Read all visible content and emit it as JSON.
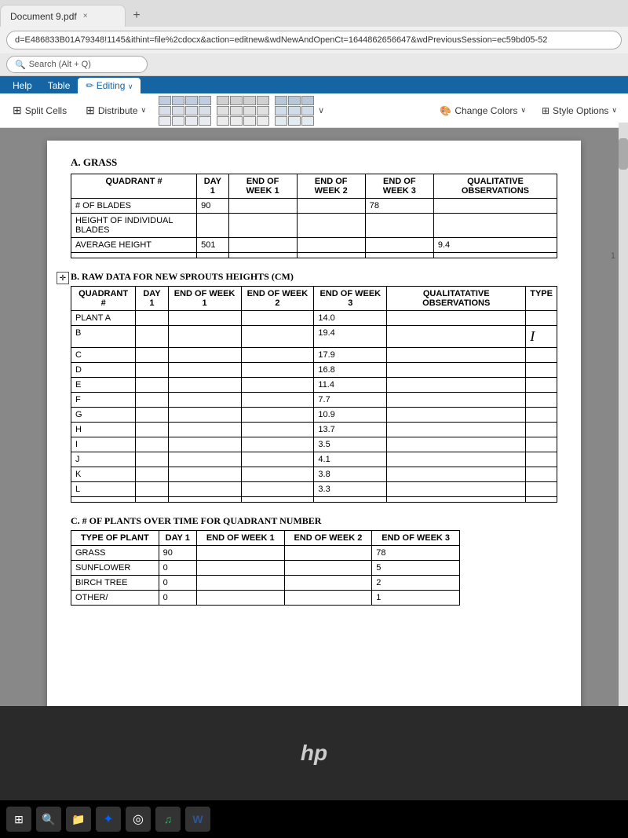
{
  "browser": {
    "tab_label": "Document 9.pdf",
    "tab_close": "×",
    "tab_new": "+",
    "address_url": "d=E486833B01A79348!1145&ithint=file%2cdocx&action=editnew&wdNewAndOpenCt=1644862656647&wdPreviousSession=ec59bd05-52",
    "search_placeholder": "Search (Alt + Q)"
  },
  "ribbon": {
    "tabs": [
      "Help",
      "Table",
      "Editing",
      "Distribute"
    ],
    "active_tab": "Editing",
    "toolbar": {
      "split_cells_label": "Split Cells",
      "distribute_label": "Distribute",
      "change_colors_label": "Change Colors",
      "style_options_label": "Style Options"
    }
  },
  "document": {
    "section_a": {
      "label": "A.   GRASS",
      "headers": [
        "QUADRANT #",
        "DAY 1",
        "END OF WEEK 1",
        "END OF WEEK 2",
        "END OF WEEK 3",
        "QUALITATIVE OBSERVATIONS"
      ],
      "rows": [
        [
          "# OF BLADES",
          "90",
          "",
          "",
          "78",
          ""
        ],
        [
          "HEIGHT OF INDIVIDUAL BLADES",
          "",
          "",
          "",
          "",
          ""
        ],
        [
          "AVERAGE HEIGHT",
          "501",
          "",
          "",
          "",
          "9.4"
        ],
        [
          "",
          "",
          "",
          "",
          "",
          ""
        ]
      ]
    },
    "section_b": {
      "label": "B.   RAW DATA FOR NEW SPROUTS   HEIGHTS (CM)",
      "headers": [
        "QUADRANT #",
        "DAY 1",
        "END OF WEEK 1",
        "END OF WEEK 2",
        "END OF WEEK 3",
        "QUALITATATIVE OBSERVATIONS",
        "TYPE"
      ],
      "rows": [
        [
          "PLANT A",
          "",
          "",
          "",
          "14.0",
          "",
          ""
        ],
        [
          "B",
          "",
          "",
          "",
          "19.4",
          "",
          ""
        ],
        [
          "C",
          "",
          "",
          "",
          "17.9",
          "",
          ""
        ],
        [
          "D",
          "",
          "",
          "",
          "16.8",
          "",
          ""
        ],
        [
          "E",
          "",
          "",
          "",
          "11.4",
          "",
          ""
        ],
        [
          "F",
          "",
          "",
          "",
          "7.7",
          "",
          ""
        ],
        [
          "G",
          "",
          "",
          "",
          "10.9",
          "",
          ""
        ],
        [
          "H",
          "",
          "",
          "",
          "13.7",
          "",
          ""
        ],
        [
          "I",
          "",
          "",
          "",
          "3.5",
          "",
          ""
        ],
        [
          "J",
          "",
          "",
          "",
          "4.1",
          "",
          ""
        ],
        [
          "K",
          "",
          "",
          "",
          "3.8",
          "",
          ""
        ],
        [
          "L",
          "",
          "",
          "",
          "3.3",
          "",
          ""
        ],
        [
          "",
          "",
          "",
          "",
          "",
          "",
          ""
        ]
      ]
    },
    "section_c": {
      "label": "C.   # OF PLANTS OVER TIME FOR QUADRANT NUMBER",
      "headers": [
        "TYPE OF PLANT",
        "DAY 1",
        "END OF WEEK 1",
        "END OF WEEK 2",
        "END OF WEEK 3"
      ],
      "rows": [
        [
          "GRASS",
          "90",
          "",
          "",
          "78"
        ],
        [
          "SUNFLOWER",
          "0",
          "",
          "",
          "5"
        ],
        [
          "BIRCH TREE",
          "0",
          "",
          "",
          "2"
        ],
        [
          "OTHER/",
          "0",
          "",
          "",
          "1"
        ]
      ]
    }
  },
  "page_number": "1",
  "icons": {
    "editing": "✏",
    "distribute": "⊞",
    "split_cells": "⊞",
    "change_colors": "🎨",
    "style_options": "⊞",
    "chevron": "∨",
    "search": "🔍",
    "table_move": "✛"
  }
}
